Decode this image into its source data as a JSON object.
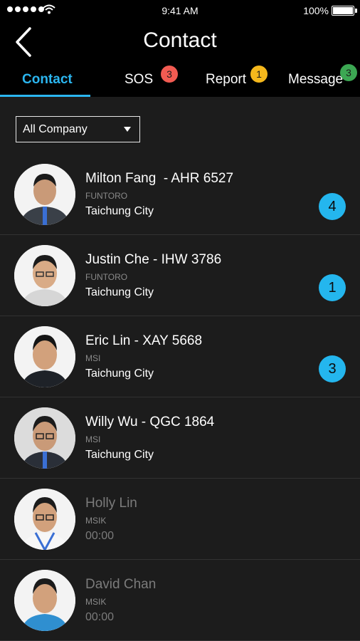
{
  "status_bar": {
    "time": "9:41 AM",
    "battery": "100%"
  },
  "header": {
    "title": "Contact",
    "back_icon": "chevron-left-icon"
  },
  "tabs": [
    {
      "label": "Contact",
      "active": true
    },
    {
      "label": "SOS",
      "badge": "3",
      "badge_color": "#f25b52"
    },
    {
      "label": "Report",
      "badge": "1",
      "badge_color": "#f5b81c"
    },
    {
      "label": "Message",
      "badge": "3",
      "badge_color": "#3ca753"
    }
  ],
  "filter": {
    "selected": "All Company"
  },
  "contacts": [
    {
      "name": "Milton Fang  - AHR 6527",
      "company": "FUNTORO",
      "city": "Taichung City",
      "unread": "4",
      "online": true
    },
    {
      "name": "Justin Che - IHW 3786",
      "company": "FUNTORO",
      "city": "Taichung City",
      "unread": "1",
      "online": true
    },
    {
      "name": "Eric Lin - XAY 5668",
      "company": "MSI",
      "city": "Taichung City",
      "unread": "3",
      "online": true
    },
    {
      "name": "Willy Wu - QGC 1864",
      "company": "MSI",
      "city": "Taichung City",
      "unread": "",
      "online": true
    },
    {
      "name": "Holly Lin",
      "company": "MSIK",
      "city": "00:00",
      "unread": "",
      "online": false
    },
    {
      "name": "David Chan",
      "company": "MSIK",
      "city": "00:00",
      "unread": "",
      "online": false
    }
  ],
  "colors": {
    "accent": "#2bb6f0",
    "unread_badge": "#24b6ee",
    "background": "#1c1c1c"
  }
}
